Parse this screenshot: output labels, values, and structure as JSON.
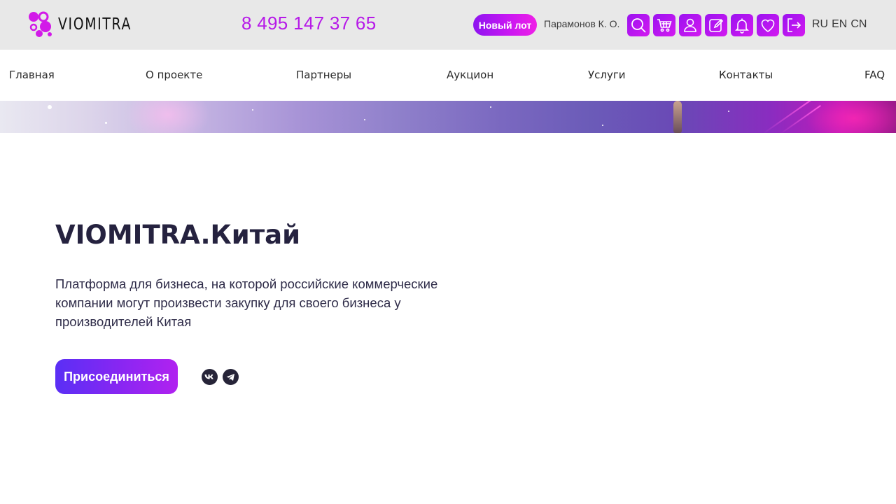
{
  "header": {
    "logo_text": "VIOMITRA",
    "phone": "8 495 147 37 65",
    "new_lot_label": "Новый лот",
    "user_name": "Парамонов К. О.",
    "icons": [
      "search-icon",
      "cart-icon",
      "user-icon",
      "edit-icon",
      "bell-icon",
      "heart-icon",
      "logout-icon"
    ],
    "languages": [
      "RU",
      "EN",
      "CN"
    ],
    "accent_color": "#b619e8"
  },
  "nav": {
    "items": [
      "Главная",
      "О проекте",
      "Партнеры",
      "Аукцион",
      "Услуги",
      "Контакты",
      "FAQ"
    ]
  },
  "hero": {
    "title": "VIOMITRA.Китай",
    "description": "Платформа для бизнеса, на которой российские коммерческие компании могут произвести закупку для своего бизнеса у производителей Китая",
    "join_label": "Присоединиться",
    "social": [
      "vk-icon",
      "telegram-icon"
    ]
  }
}
